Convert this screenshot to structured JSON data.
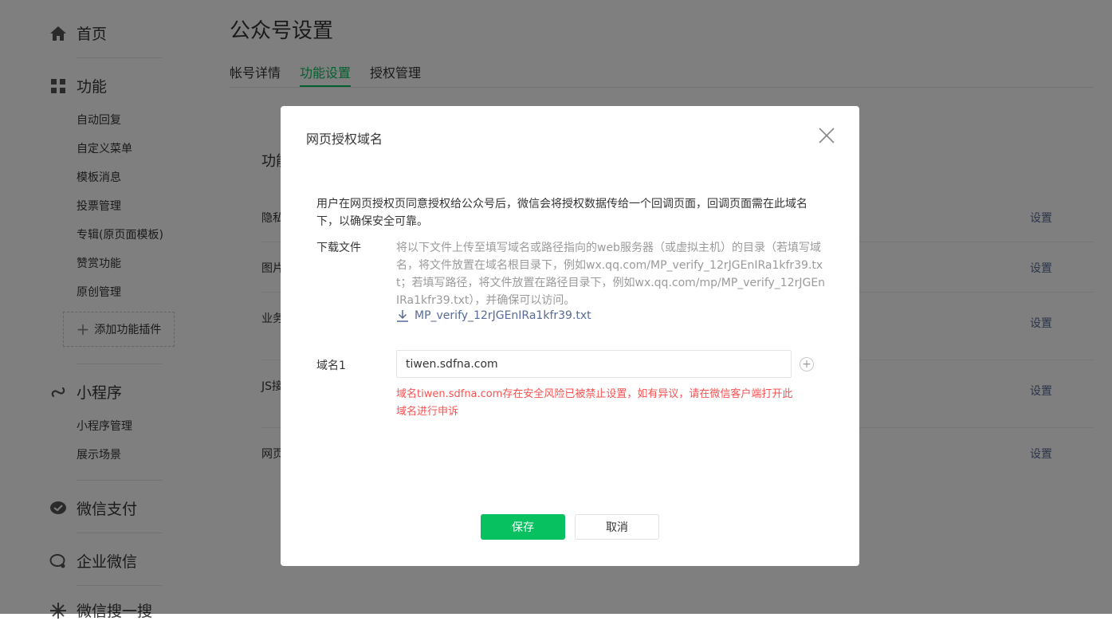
{
  "sidebar": {
    "home": "首页",
    "features": {
      "label": "功能",
      "items": [
        "自动回复",
        "自定义菜单",
        "模板消息",
        "投票管理",
        "专辑(原页面模板)",
        "赞赏功能",
        "原创管理"
      ],
      "add_plugin": "添加功能插件"
    },
    "miniprogram": {
      "label": "小程序",
      "items": [
        "小程序管理",
        "展示场景"
      ]
    },
    "pay": "微信支付",
    "work": "企业微信",
    "search": "微信搜一搜"
  },
  "main": {
    "title": "公众号设置",
    "tabs": [
      "帐号详情",
      "功能设置",
      "授权管理"
    ],
    "active_tab": "功能设置",
    "card": {
      "title": "功能",
      "rows": [
        {
          "label": "隐私",
          "action": "设置"
        },
        {
          "label": "图片",
          "action": "设置"
        },
        {
          "label": "业务",
          "action": "设置"
        },
        {
          "label": "JS接",
          "action": "设置"
        },
        {
          "label": "网页",
          "action": "设置"
        }
      ]
    }
  },
  "dialog": {
    "title": "网页授权域名",
    "intro": "用户在网页授权页同意授权给公众号后，微信会将授权数据传给一个回调页面，回调页面需在此域名下，以确保安全可靠。",
    "download": {
      "label": "下载文件",
      "desc": "将以下文件上传至填写域名或路径指向的web服务器（或虚拟主机）的目录（若填写域名，将文件放置在域名根目录下，例如wx.qq.com/MP_verify_12rJGEnIRa1kfr39.txt；若填写路径，将文件放置在路径目录下，例如wx.qq.com/mp/MP_verify_12rJGEnIRa1kfr39.txt），并确保可以访问。",
      "file": "MP_verify_12rJGEnIRa1kfr39.txt"
    },
    "domain": {
      "label": "域名1",
      "value": "tiwen.sdfna.com",
      "error": "域名tiwen.sdfna.com存在安全风险已被禁止设置，如有异议，请在微信客户端打开此域名进行申诉"
    },
    "save_label": "保存",
    "cancel_label": "取消"
  },
  "colors": {
    "accent": "#07c160",
    "link": "#576b95",
    "error": "#fa5151",
    "mask": "rgba(0,0,0,0.5)"
  },
  "icons": [
    "home-icon",
    "grid-icon",
    "miniprogram-icon",
    "wechat-pay-icon",
    "work-wechat-icon",
    "search-sparkle-icon",
    "close-icon",
    "download-icon",
    "plus-icon"
  ]
}
